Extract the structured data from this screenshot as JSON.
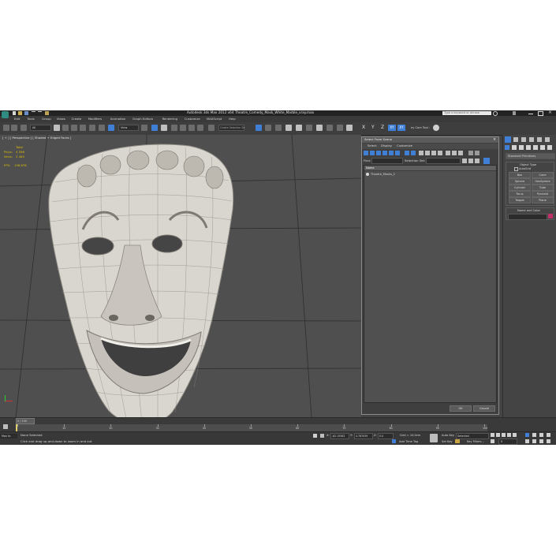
{
  "window": {
    "title": "Autodesk 3ds Max  2012 x64     Theatre_Comedy_Mask_White_Marble_vray.max",
    "search_placeholder": "Type a keyword or phrase"
  },
  "menu": [
    "Edit",
    "Tools",
    "Group",
    "Views",
    "Create",
    "Modifiers",
    "Animation",
    "Graph Editors",
    "Rendering",
    "Customize",
    "MAXScript",
    "Help"
  ],
  "toolbar": {
    "selection_filter": "All",
    "ref_coord": "View",
    "named_selection": "Create Selection Se",
    "axis_x": "X",
    "axis_y": "Y",
    "axis_z": "Z",
    "axis_xy": "XY",
    "axis_xy2": "XY",
    "cam_tool": "ey Cam Tool :"
  },
  "viewport": {
    "label": "[ + ] [ Perspective ] [ Shaded + Edged Faces ]",
    "stats_header": "Total",
    "polys_label": "Polys:",
    "polys_value": "4 596",
    "verts_label": "Verts:",
    "verts_value": "2 465",
    "fps_label": "FPS:",
    "fps_value": "136.876"
  },
  "dialog": {
    "title": "Select From Scene",
    "tabs": [
      "Select",
      "Display",
      "Customize"
    ],
    "find_label": "Find:",
    "selection_set_label": "Selection Set:",
    "column_header": "Name",
    "items": [
      "Theatre_Masks_2"
    ],
    "ok": "OK",
    "cancel": "Cancel"
  },
  "command_panel": {
    "dropdown": "Standard Primitives",
    "object_type_header": "Object Type",
    "autogrid": "AutoGrid",
    "buttons": [
      "Box",
      "Cone",
      "Sphere",
      "GeoSphere",
      "Cylinder",
      "Tube",
      "Torus",
      "Pyramid",
      "Teapot",
      "Plane"
    ],
    "name_color_header": "Name and Color"
  },
  "timeline": {
    "frame_counter": "0 / 100",
    "ticks": [
      "0",
      "10",
      "20",
      "30",
      "40",
      "50",
      "60",
      "70",
      "80",
      "90",
      "100"
    ]
  },
  "status": {
    "script_label": "Max to",
    "selection_text": "None Selected",
    "prompt_text": "Click and drag up-and-down to zoom in and out",
    "x_label": "X:",
    "x_value": "-82.15562",
    "y_label": "Y:",
    "y_value": "4.787039",
    "z_label": "Z:",
    "z_value": "0.0",
    "grid": "Grid = 10.0cm",
    "add_time_tag": "Add Time Tag",
    "auto_key": "Auto Key",
    "selected": "Selected",
    "set_key": "Set Key",
    "key_filters": "Key Filters...",
    "frame": "0"
  },
  "colors": {
    "accent": "#3f7fd6",
    "stats_yellow": "#e0c000",
    "mask": "#d9d6d0",
    "viewport_bg": "#505050"
  }
}
